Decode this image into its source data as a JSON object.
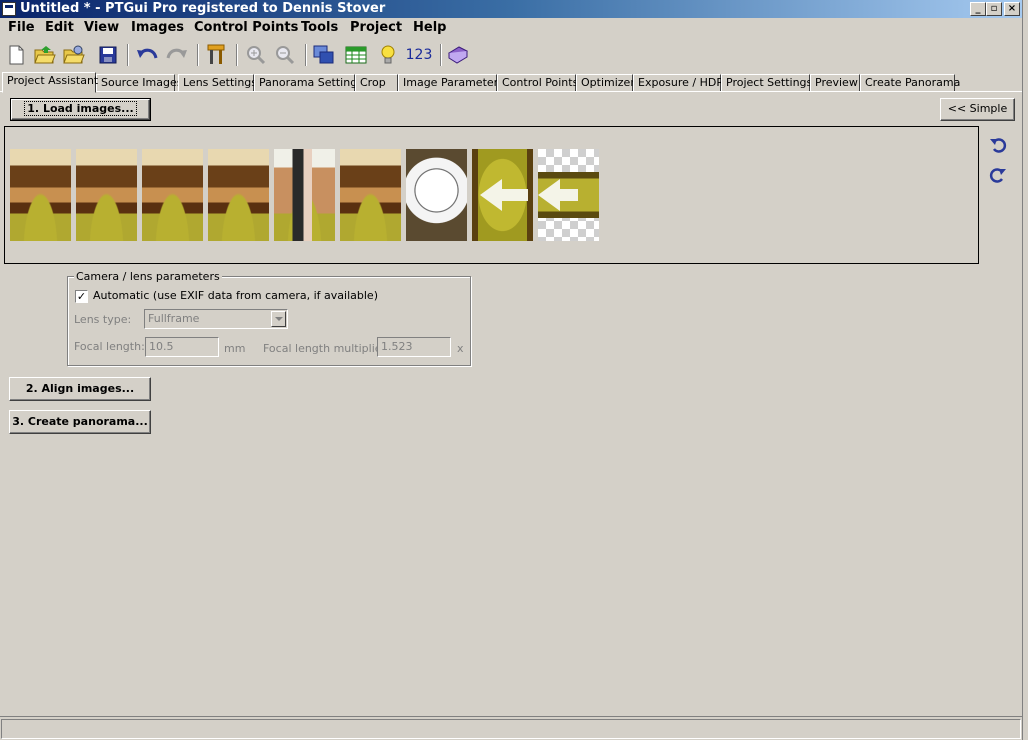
{
  "window": {
    "title": "Untitled * - PTGui Pro registered to Dennis Stover"
  },
  "menu": [
    "File",
    "Edit",
    "View",
    "Images",
    "Control Points",
    "Tools",
    "Project",
    "Help"
  ],
  "toolbar": {
    "icons": [
      "new-project-icon",
      "open-project-icon",
      "open-recent-icon",
      "save-icon",
      "undo-icon",
      "redo-icon",
      "tools-icon",
      "zoom-in-icon",
      "zoom-out-icon",
      "panorama-editor-icon",
      "control-point-table-icon",
      "tips-icon",
      "numbers-icon",
      "help-book-icon"
    ],
    "numbers_label": "123"
  },
  "tabs": [
    "Project Assistant",
    "Source Images",
    "Lens Settings",
    "Panorama Settings",
    "Crop",
    "Image Parameters",
    "Control Points",
    "Optimizer",
    "Exposure / HDR",
    "Project Settings",
    "Preview",
    "Create Panorama"
  ],
  "assistant": {
    "load_button": "1. Load images...",
    "simple_button": "<< Simple",
    "align_button": "2. Align images...",
    "create_button": "3. Create panorama..."
  },
  "thumbnails": [
    {
      "type": "kitchen"
    },
    {
      "type": "kitchen"
    },
    {
      "type": "kitchen"
    },
    {
      "type": "kitchen"
    },
    {
      "type": "hallway"
    },
    {
      "type": "kitchen"
    },
    {
      "type": "ceiling"
    },
    {
      "type": "floor"
    },
    {
      "type": "transparent"
    }
  ],
  "camera": {
    "group_label": "Camera / lens parameters",
    "auto_checked": true,
    "auto_label": "Automatic (use EXIF data from camera, if available)",
    "lens_type_label": "Lens type:",
    "lens_type_value": "Fullframe",
    "focal_length_label": "Focal length:",
    "focal_length_value": "10.5",
    "focal_unit": "mm",
    "multiplier_label": "Focal length multiplier:",
    "multiplier_value": "1.523",
    "multiplier_unit": "x"
  },
  "colors": {
    "titlebar": "#0a246a",
    "face": "#d4d0c8",
    "accent": "#2a3a9a"
  }
}
